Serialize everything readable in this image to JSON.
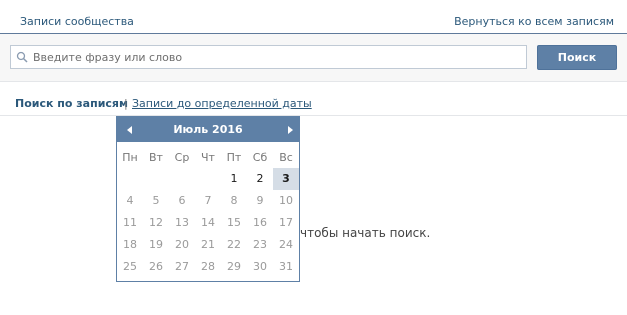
{
  "header": {
    "title": "Записи сообщества",
    "back_link": "Вернуться ко всем записям"
  },
  "search": {
    "placeholder": "Введите фразу или слово",
    "value": "",
    "button_label": "Поиск"
  },
  "tabs": {
    "active": "Поиск по записям",
    "separator": "|",
    "date_link": "Записи до определенной даты"
  },
  "hint_text": "чтобы начать поиск.",
  "calendar": {
    "month_label": "Июль 2016",
    "weekdays": [
      "Пн",
      "Вт",
      "Ср",
      "Чт",
      "Пт",
      "Сб",
      "Вс"
    ],
    "selected_day": "3",
    "weeks": [
      [
        "",
        "",
        "",
        "",
        "1",
        "2",
        "3"
      ],
      [
        "4",
        "5",
        "6",
        "7",
        "8",
        "9",
        "10"
      ],
      [
        "11",
        "12",
        "13",
        "14",
        "15",
        "16",
        "17"
      ],
      [
        "18",
        "19",
        "20",
        "21",
        "22",
        "23",
        "24"
      ],
      [
        "25",
        "26",
        "27",
        "28",
        "29",
        "30",
        "31"
      ]
    ],
    "available_days": [
      "1",
      "2",
      "3"
    ]
  },
  "icons": {
    "search": "magnifier-icon",
    "prev": "arrow-left-icon",
    "next": "arrow-right-icon"
  },
  "colors": {
    "accent": "#5e80a6",
    "link": "#2b587a",
    "selected_day_bg": "#d5dde6"
  }
}
